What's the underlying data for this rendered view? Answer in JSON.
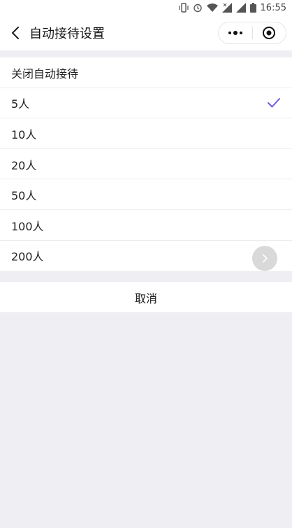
{
  "status_bar": {
    "time": "16:55",
    "icons": [
      "vibrate-icon",
      "alarm-icon",
      "wifi-icon",
      "signal-icon",
      "signal-icon",
      "battery-icon"
    ]
  },
  "nav": {
    "title": "自动接待设置",
    "back_icon": "chevron-left-icon",
    "more_icon": "more-dots-icon",
    "close_icon": "target-close-icon"
  },
  "options": [
    {
      "label": "关闭自动接待",
      "selected": false
    },
    {
      "label": "5人",
      "selected": true
    },
    {
      "label": "10人",
      "selected": false
    },
    {
      "label": "20人",
      "selected": false
    },
    {
      "label": "50人",
      "selected": false
    },
    {
      "label": "100人",
      "selected": false
    },
    {
      "label": "200人",
      "selected": false
    }
  ],
  "cancel_label": "取消",
  "colors": {
    "accent": "#6c5ce7",
    "background": "#eeeef3"
  }
}
